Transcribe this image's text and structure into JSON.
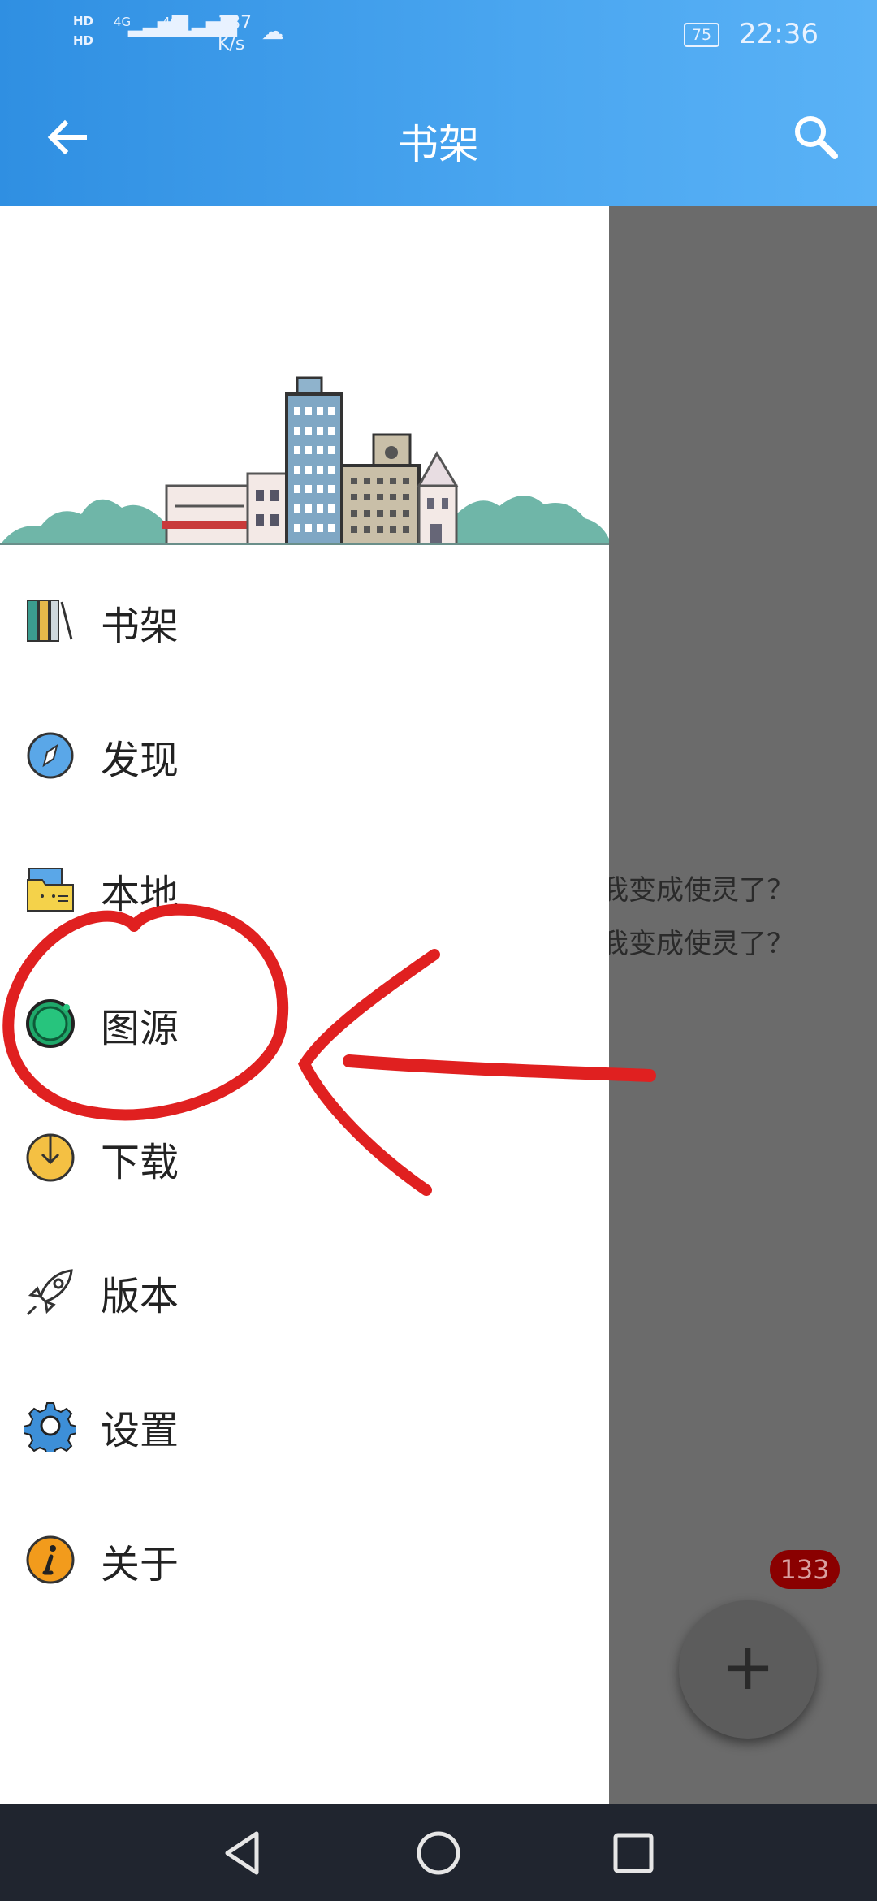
{
  "status_bar": {
    "hd1": "HD",
    "hd2": "HD",
    "net1": "4G",
    "net2": "4G",
    "speed_value": "187",
    "speed_unit": "K/s",
    "battery": "75",
    "time": "22:36"
  },
  "app_bar": {
    "title": "书架",
    "back_icon": "arrow-left-icon",
    "search_icon": "search-icon"
  },
  "background_list": {
    "line1": "我变成使灵了？",
    "line2": "我变成使灵了？",
    "unread_badge": "133",
    "fab_label": "+"
  },
  "drawer": {
    "header_image": "city-skyline-illustration",
    "items": [
      {
        "label": "书架",
        "icon": "bookshelf-icon"
      },
      {
        "label": "发现",
        "icon": "compass-icon"
      },
      {
        "label": "本地",
        "icon": "folder-icon"
      },
      {
        "label": "图源",
        "icon": "source-icon"
      },
      {
        "label": "下载",
        "icon": "download-icon"
      },
      {
        "label": "版本",
        "icon": "rocket-icon"
      },
      {
        "label": "设置",
        "icon": "gear-icon"
      },
      {
        "label": "关于",
        "icon": "info-icon"
      }
    ]
  },
  "colors": {
    "appbar": "#3a9ae8",
    "annotation": "#e02020",
    "drawer_bg": "#ffffff",
    "scrim": "#6b6b6b"
  },
  "nav_bar": {
    "back": "nav-back-icon",
    "home": "nav-home-icon",
    "recents": "nav-recents-icon"
  }
}
